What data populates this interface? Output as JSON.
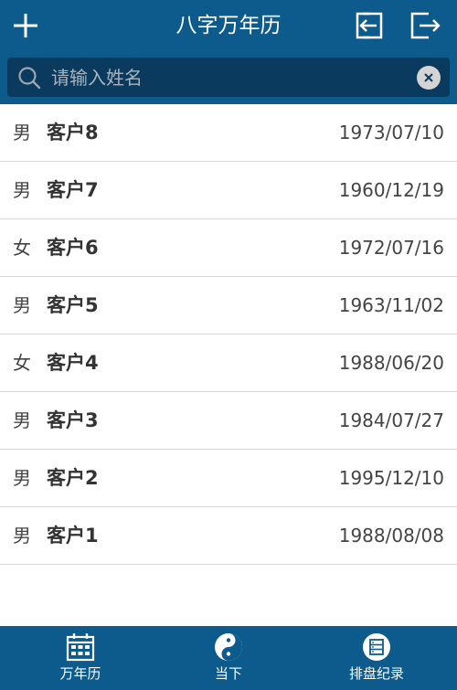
{
  "header": {
    "title": "八字万年历",
    "add_icon": "plus-icon",
    "import_icon": "import-icon",
    "logout_icon": "logout-icon"
  },
  "search": {
    "placeholder": "请输入姓名",
    "value": ""
  },
  "clients": [
    {
      "gender": "男",
      "name": "客户8",
      "date": "1973/07/10"
    },
    {
      "gender": "男",
      "name": "客户7",
      "date": "1960/12/19"
    },
    {
      "gender": "女",
      "name": "客户6",
      "date": "1972/07/16"
    },
    {
      "gender": "男",
      "name": "客户5",
      "date": "1963/11/02"
    },
    {
      "gender": "女",
      "name": "客户4",
      "date": "1988/06/20"
    },
    {
      "gender": "男",
      "name": "客户3",
      "date": "1984/07/27"
    },
    {
      "gender": "男",
      "name": "客户2",
      "date": "1995/12/10"
    },
    {
      "gender": "男",
      "name": "客户1",
      "date": "1988/08/08"
    }
  ],
  "tabs": [
    {
      "label": "万年历",
      "icon": "calendar-icon"
    },
    {
      "label": "当下",
      "icon": "yin-yang-icon"
    },
    {
      "label": "排盘纪录",
      "icon": "records-icon"
    }
  ],
  "colors": {
    "primary": "#0d5a8c",
    "search_bg": "#0a3b5e",
    "divider": "#d6d6d6"
  }
}
